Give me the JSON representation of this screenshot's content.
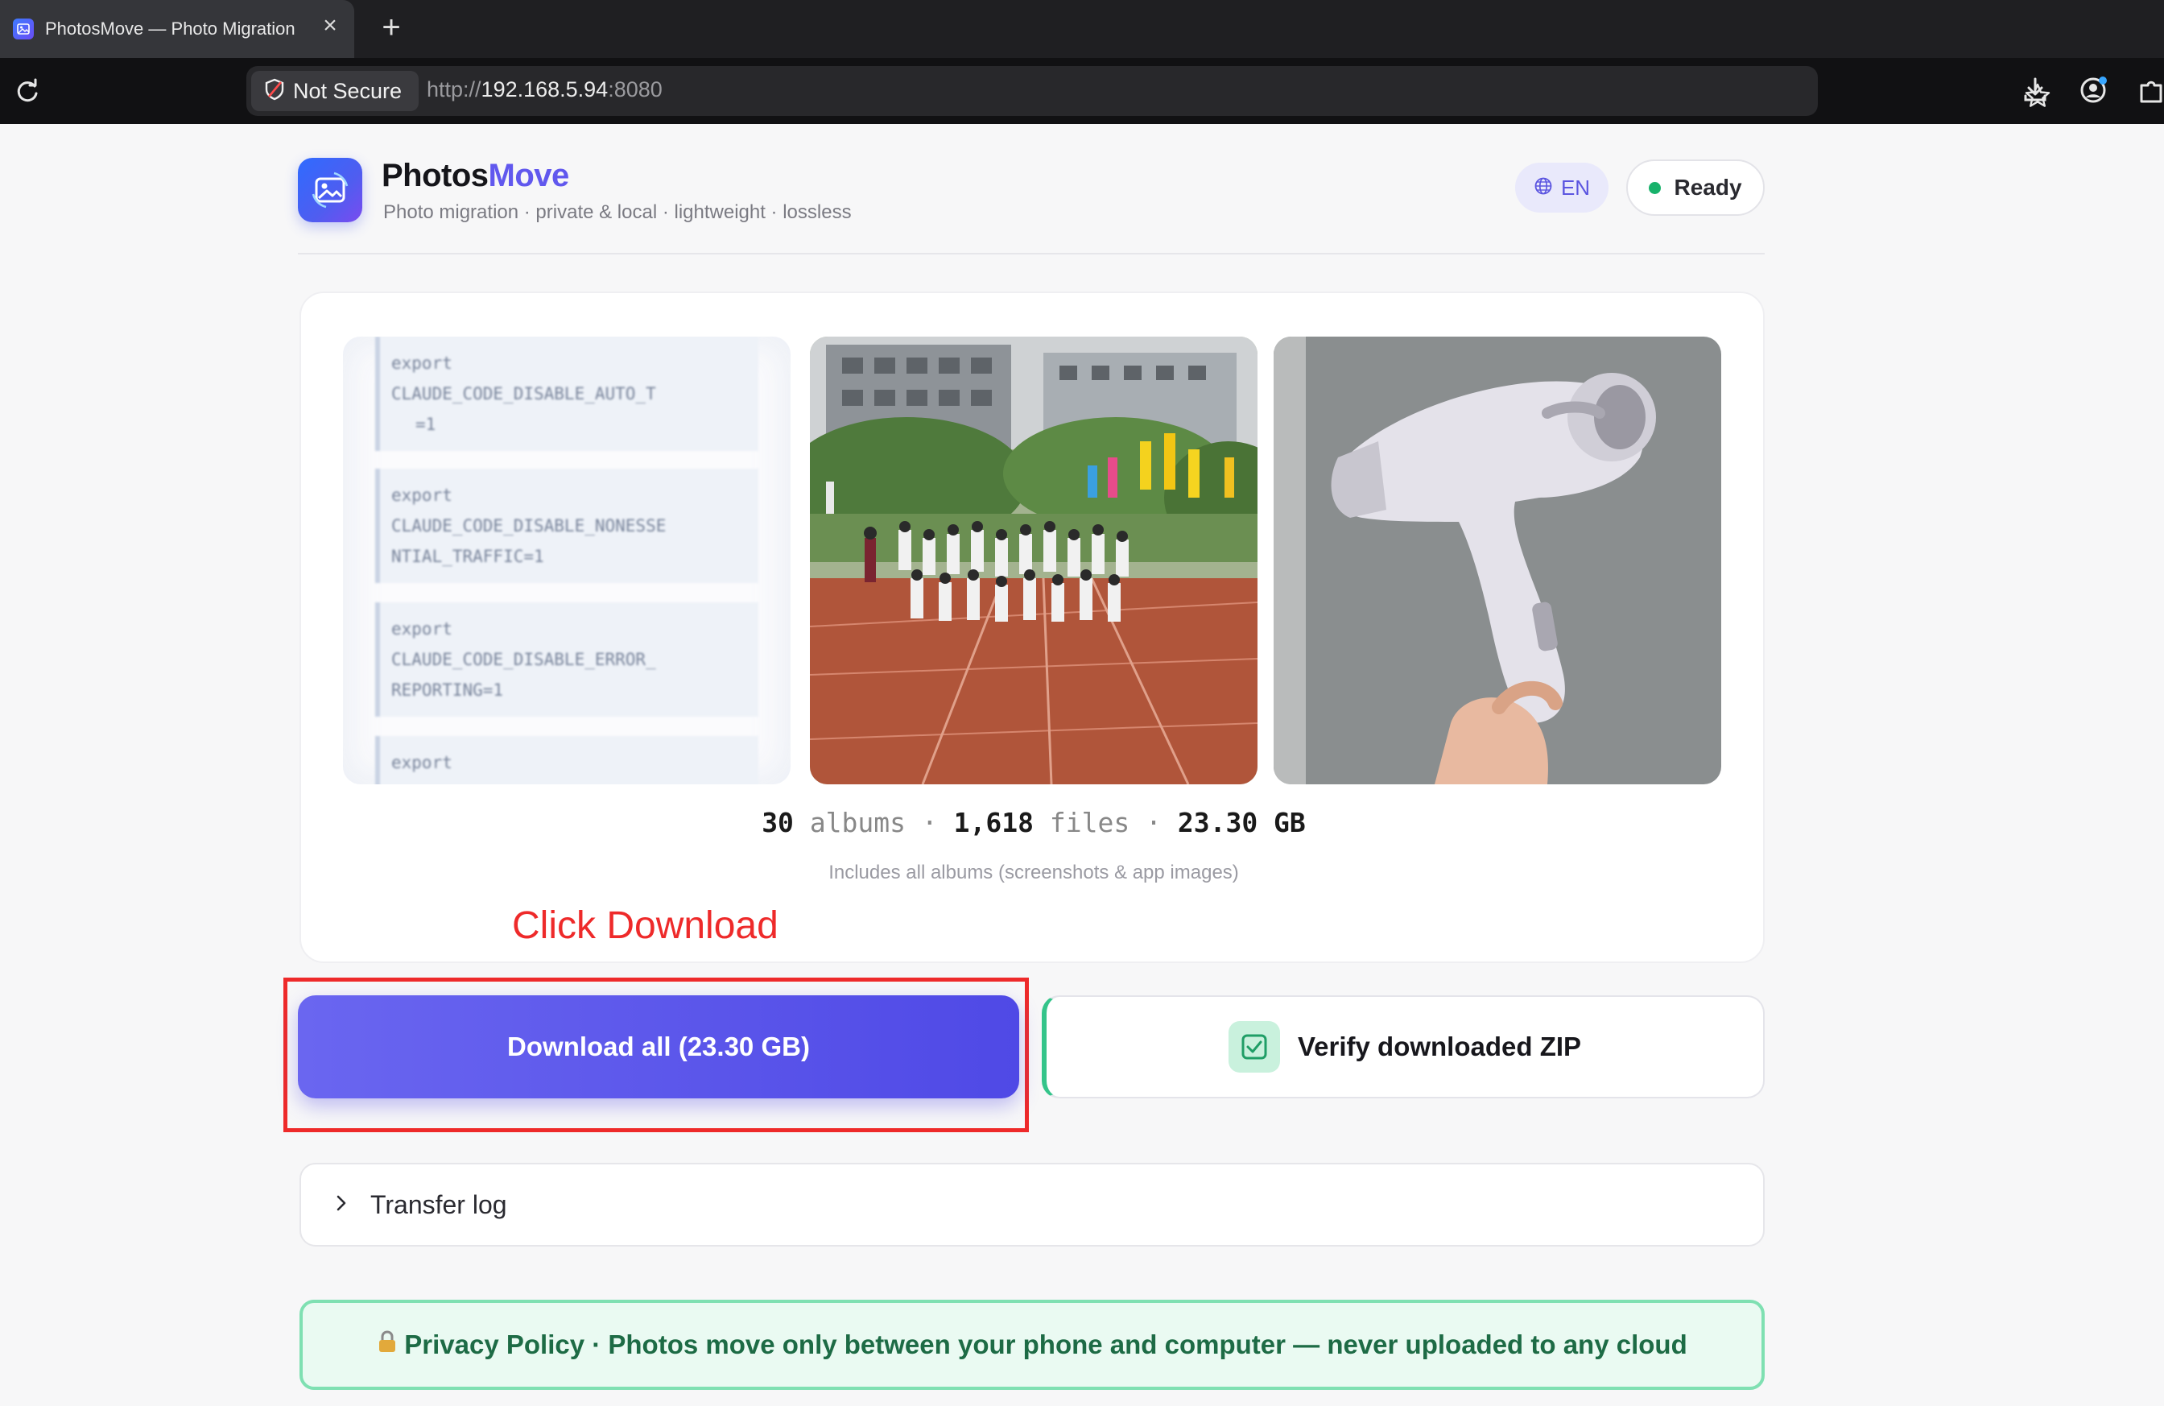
{
  "browser": {
    "tab_title": "PhotosMove — Photo Migration",
    "security_label": "Not Secure",
    "url_scheme": "http://",
    "url_host": "192.168.5.94",
    "url_port": ":8080"
  },
  "header": {
    "brand_main": "Photos",
    "brand_accent": "Move",
    "tagline": "Photo migration · private & local · lightweight · lossless",
    "language": "EN",
    "status": "Ready"
  },
  "preview": {
    "code_blocks": [
      [
        "export",
        "CLAUDE_CODE_DISABLE_AUTO_T",
        "=1"
      ],
      [
        "export",
        "CLAUDE_CODE_DISABLE_NONESSE",
        "NTIAL_TRAFFIC=1"
      ],
      [
        "export",
        "CLAUDE_CODE_DISABLE_ERROR_",
        "REPORTING=1"
      ],
      [
        "export"
      ]
    ]
  },
  "stats": {
    "albums_count": "30",
    "albums_label": "albums",
    "files_count": "1,618",
    "files_label": "files",
    "size": "23.30 GB",
    "separator": "·",
    "note": "Includes all albums (screenshots & app images)"
  },
  "annotation": "Click Download",
  "actions": {
    "download_label": "Download all (23.30 GB)",
    "verify_label": "Verify downloaded ZIP"
  },
  "log": {
    "label": "Transfer log"
  },
  "privacy": {
    "text": "Privacy Policy · Photos move only between your phone and computer — never uploaded to any cloud"
  }
}
